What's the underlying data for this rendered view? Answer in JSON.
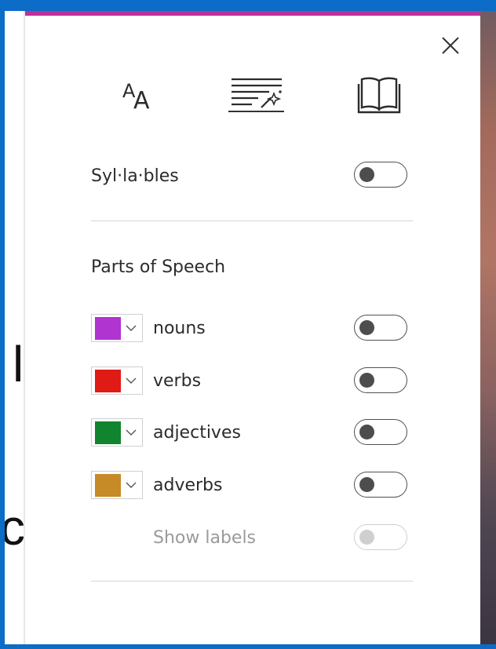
{
  "panel": {
    "accent_color": "#c0309a",
    "close_icon": "close-icon",
    "tabs": [
      {
        "name": "text-preferences",
        "icon": "text-size-icon",
        "selected": false
      },
      {
        "name": "grammar-tools",
        "icon": "grammar-wand-icon",
        "selected": true
      },
      {
        "name": "reading-preferences",
        "icon": "book-icon",
        "selected": false
      }
    ],
    "syllables": {
      "label": "Syl·la·bles",
      "on": false
    },
    "parts_of_speech": {
      "title": "Parts of Speech",
      "items": [
        {
          "label": "nouns",
          "color": "#b034d0",
          "on": false
        },
        {
          "label": "verbs",
          "color": "#e01b16",
          "on": false
        },
        {
          "label": "adjectives",
          "color": "#10842e",
          "on": false
        },
        {
          "label": "adverbs",
          "color": "#c68b26",
          "on": false
        }
      ],
      "show_labels": {
        "label": "Show labels",
        "on": false,
        "disabled": true
      }
    }
  }
}
